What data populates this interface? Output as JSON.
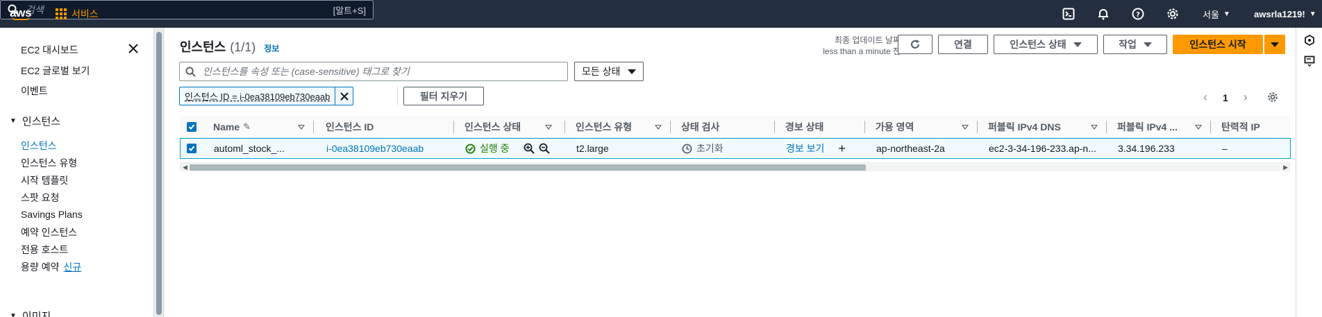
{
  "topnav": {
    "logo": "aws",
    "services_label": "서비스",
    "search_placeholder": "검색",
    "search_shortcut": "[알트+S]",
    "region": "서울",
    "account": "awsrla1219!"
  },
  "sidebar": {
    "items_top": [
      "EC2 대시보드",
      "EC2 글로벌 보기",
      "이벤트"
    ],
    "section_instances": "인스턴스",
    "items_instances": [
      "인스턴스",
      "인스턴스 유형",
      "시작 템플릿",
      "스팟 요청",
      "Savings Plans",
      "예약 인스턴스",
      "전용 호스트",
      "용량 예약"
    ],
    "new_badge": "신규",
    "section_images": "이미지"
  },
  "main": {
    "title": "인스턴스",
    "count": "(1/1)",
    "info_link": "정보",
    "last_update_label": "최종 업데이트 날짜",
    "last_update_value": "less than a minute 전",
    "buttons": {
      "connect": "연결",
      "instance_state": "인스턴스 상태",
      "actions": "작업",
      "launch": "인스턴스 시작"
    },
    "filter_placeholder": "인스턴스를 속성 또는 (case-sensitive) 태그로 찾기",
    "state_select": "모든 상태",
    "filter_token": "인스턴스 ID = i-0ea38109eb730eaab",
    "clear_filters": "필터 지우기",
    "page": "1"
  },
  "table": {
    "headers": {
      "name": "Name",
      "instance_id": "인스턴스 ID",
      "instance_state": "인스턴스 상태",
      "instance_type": "인스턴스 유형",
      "status_check": "상태 검사",
      "alarm_status": "경보 상태",
      "az": "가용 영역",
      "public_dns": "퍼블릭 IPv4 DNS",
      "public_ip": "퍼블릭 IPv4 ...",
      "elastic_ip": "탄력적 IP"
    },
    "row": {
      "name": "automl_stock_...",
      "instance_id": "i-0ea38109eb730eaab",
      "state": "실행 중",
      "type": "t2.large",
      "status_check": "초기화",
      "alarm": "경보 보기",
      "az": "ap-northeast-2a",
      "public_dns": "ec2-3-34-196-233.ap-n...",
      "public_ip": "3.34.196.233",
      "elastic_ip": "–"
    }
  },
  "colors": {
    "nav_bg": "#232f3e",
    "accent_orange": "#ff9900",
    "link_blue": "#0073bb",
    "running_green": "#1d8102"
  }
}
